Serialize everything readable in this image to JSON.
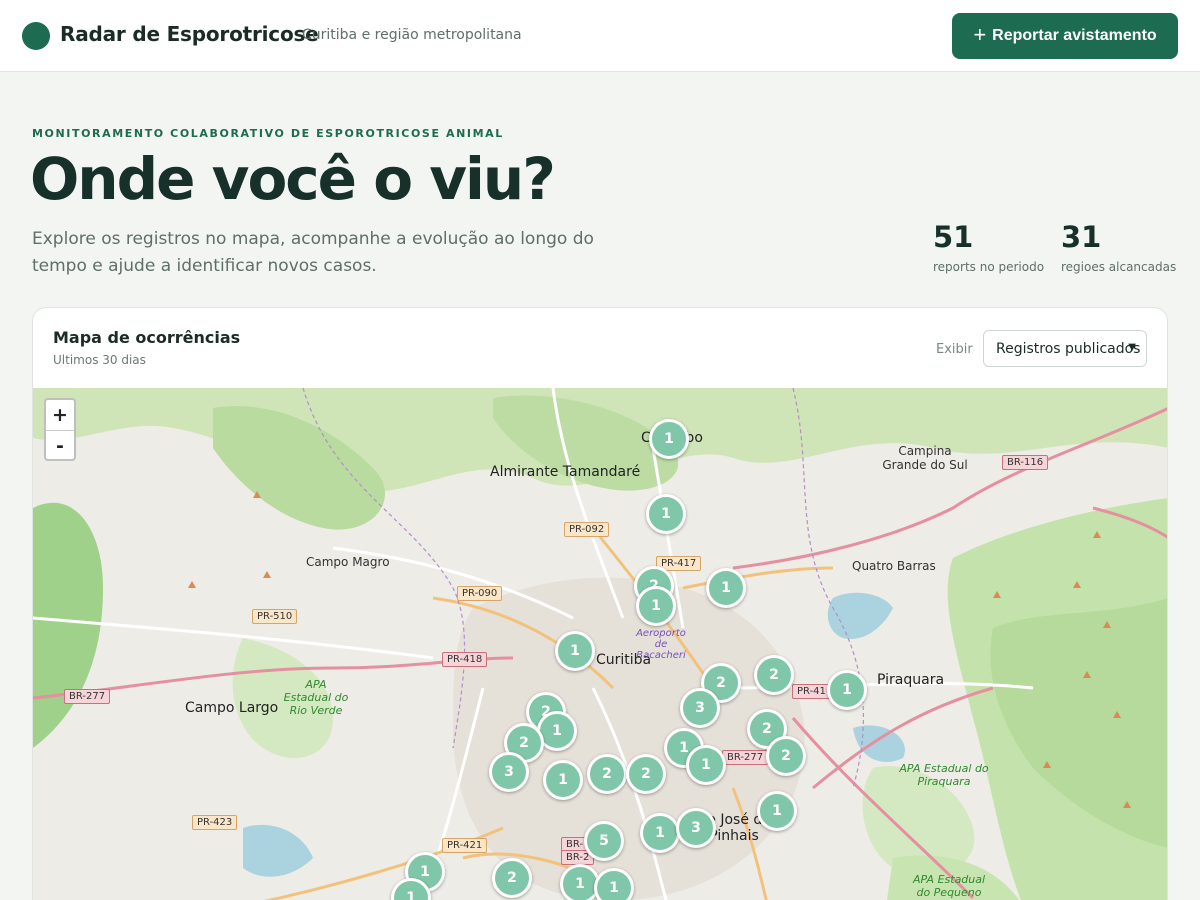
{
  "header": {
    "brand_name": "Radar de Esporotricose",
    "brand_subtitle": "Curitiba e região metropolitana",
    "report_button_label": "Reportar avistamento",
    "report_button_icon": "plus-icon"
  },
  "hero": {
    "eyebrow": "MONITORAMENTO COLABORATIVO DE ESPOROTRICOSE ANIMAL",
    "title": "Onde você o viu?",
    "description": "Explore os registros no mapa, acompanhe a evolução ao longo do tempo e ajude a identificar novos casos.",
    "stats": [
      {
        "value": "51",
        "label": "reports no periodo"
      },
      {
        "value": "31",
        "label": "regioes alcancadas"
      }
    ]
  },
  "map_card": {
    "title": "Mapa de ocorrências",
    "subtitle": "Ultimos 30 dias",
    "filter_label": "Exibir",
    "filter_value": "Registros publicados",
    "zoom_in_label": "+",
    "zoom_out_label": "-",
    "places": {
      "almirante": "Almirante Tamandaré",
      "colombo": "Colombo",
      "campina": "Campina Grande do Sul",
      "campo_magro": "Campo Magro",
      "quatro_barras": "Quatro Barras",
      "curitiba": "Curitiba",
      "piraquara": "Piraquara",
      "campo_largo": "Campo Largo",
      "sao_jose": "São José dos Pinhais",
      "apa_rio_verde": "APA Estadual do Rio Verde",
      "apa_piraquara": "APA Estadual do Piraquara",
      "apa_pequeno": "APA Estadual do Pequeno",
      "aeroporto": "Aeroporto de Bacacheri"
    },
    "roads": {
      "br116": "BR-116",
      "pr092": "PR-092",
      "pr417": "PR-417",
      "pr090": "PR-090",
      "pr510": "PR-510",
      "pr418": "PR-418",
      "br277a": "BR-277",
      "pr41x": "PR-41",
      "br277b": "BR-277",
      "pr423": "PR-423",
      "pr421": "PR-421",
      "br_a": "BR-",
      "br_b": "BR-2"
    },
    "clusters": [
      {
        "count": "1"
      },
      {
        "count": "1"
      },
      {
        "count": "2"
      },
      {
        "count": "1"
      },
      {
        "count": "1"
      },
      {
        "count": "1"
      },
      {
        "count": "2"
      },
      {
        "count": "2"
      },
      {
        "count": "1"
      },
      {
        "count": "3"
      },
      {
        "count": "2"
      },
      {
        "count": "1"
      },
      {
        "count": "2"
      },
      {
        "count": "2"
      },
      {
        "count": "1"
      },
      {
        "count": "2"
      },
      {
        "count": "1"
      },
      {
        "count": "3"
      },
      {
        "count": "2"
      },
      {
        "count": "2"
      },
      {
        "count": "1"
      },
      {
        "count": "1"
      },
      {
        "count": "5"
      },
      {
        "count": "1"
      },
      {
        "count": "3"
      },
      {
        "count": "1"
      },
      {
        "count": "1"
      },
      {
        "count": "2"
      },
      {
        "count": "1"
      },
      {
        "count": "1"
      }
    ]
  }
}
